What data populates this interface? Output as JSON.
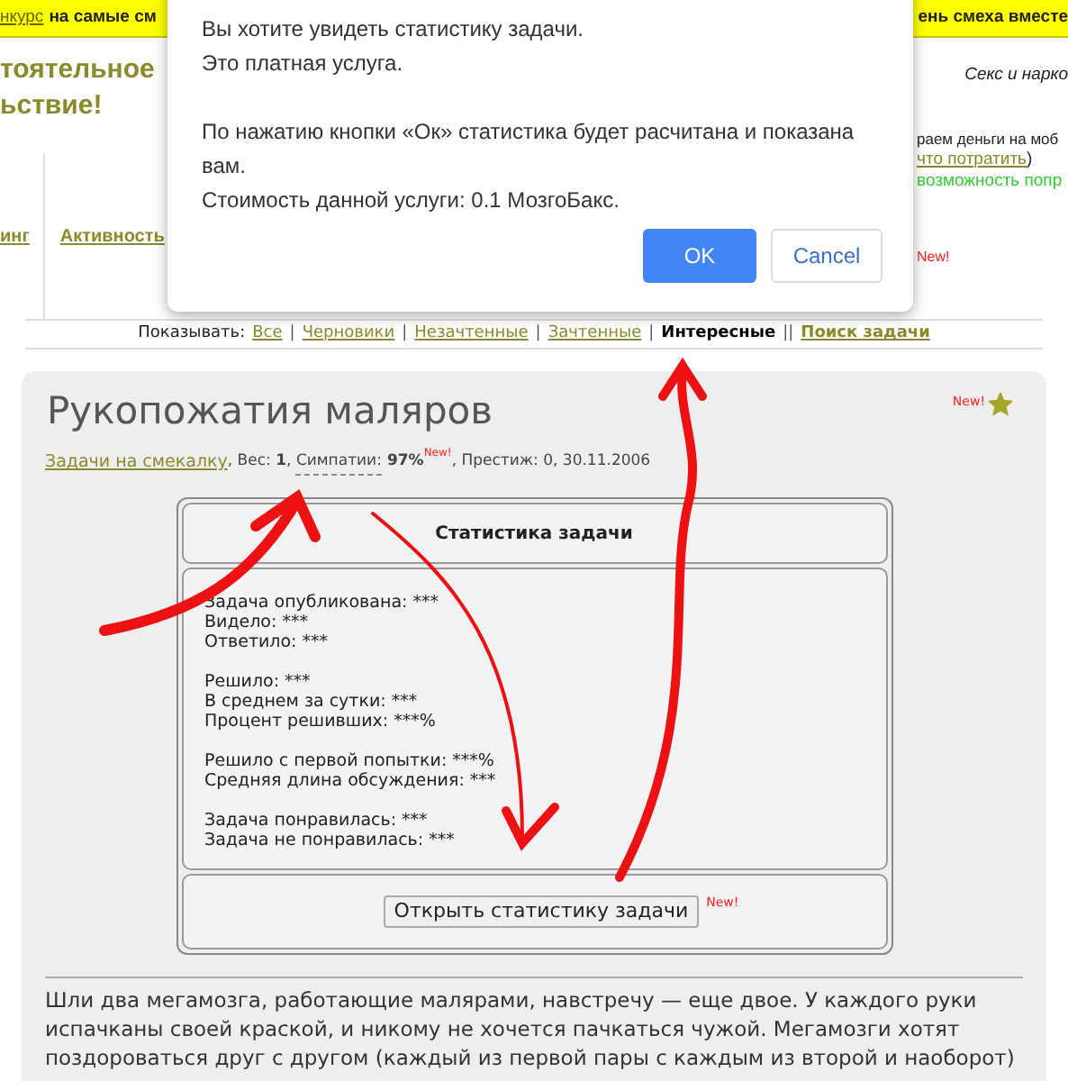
{
  "top_banner": {
    "link": "нкурс",
    "text": "на самые см",
    "right_text": "ень смеха вместе"
  },
  "header": {
    "slogan": [
      "тоятельное",
      "ьствие!"
    ],
    "tabs": [
      {
        "label": "инг"
      },
      {
        "label": "Активность"
      }
    ],
    "tagline": "Секс и нарко",
    "money_text": "раем деньги на моб",
    "spend_link": "что потратить",
    "spend_close": ")",
    "chance_text": "возможность попр",
    "new_badge": "New!"
  },
  "nav": {
    "label": "Показывать:",
    "items": [
      {
        "label": "Все",
        "selected": false,
        "kind": "link",
        "separator": "|"
      },
      {
        "label": "Черновики",
        "selected": false,
        "kind": "link",
        "separator": "|"
      },
      {
        "label": "Незачтенные",
        "selected": false,
        "kind": "link",
        "separator": "|"
      },
      {
        "label": "Зачтенные",
        "selected": false,
        "kind": "link",
        "separator": "|"
      },
      {
        "label": "Интересные",
        "selected": true,
        "kind": "link",
        "separator": "||"
      },
      {
        "label": "Поиск задачи",
        "selected": false,
        "kind": "search"
      }
    ]
  },
  "task": {
    "title": "Рукопожатия маляров",
    "new_badge": "New!",
    "favorite": true,
    "meta": {
      "category": "Задачи на смекалку",
      "weight": ", Вес: **1**, ",
      "sympathy_label": "Симпатии:",
      "sympathy_value": "97%",
      "new_badge": "New!",
      "tail": ", Престиж: 0, 30.11.2006"
    },
    "stats": {
      "title": "Статистика задачи",
      "groups": [
        [
          "Задача опубликована: ***",
          "Видело: ***",
          "Ответило: ***"
        ],
        [
          "Решило: ***",
          "В среднем за сутки: ***",
          "Процент решивших: ***%"
        ],
        [
          "Решило с первой попытки: ***%",
          "Средняя длина обсуждения: ***"
        ],
        [
          "Задача понравилась: ***",
          "Задача не понравилась: ***"
        ]
      ],
      "button": "Открыть статистику задачи",
      "new_badge": "New!"
    },
    "description": "Шли два мегамозга, работающие малярами, навстречу — еще двое. У каждого руки испачканы своей краской, и никому не хочется пачкаться чужой. Мегамозги хотят поздороваться друг с другом (каждый из первой пары с каждым из второй и наоборот)"
  },
  "dialog": {
    "paragraphs": [
      [
        "Вы хотите увидеть статистику задачи.",
        "Это платная услуга."
      ],
      [
        "По нажатию кнопки «Ок» статистика будет расчитана и показана вам.",
        "Стоимость данной услуги: 0.1 МозгоБакс."
      ]
    ],
    "buttons": [
      {
        "label": "OK",
        "kind": "primary"
      },
      {
        "label": "Cancel",
        "kind": "secondary"
      }
    ]
  }
}
